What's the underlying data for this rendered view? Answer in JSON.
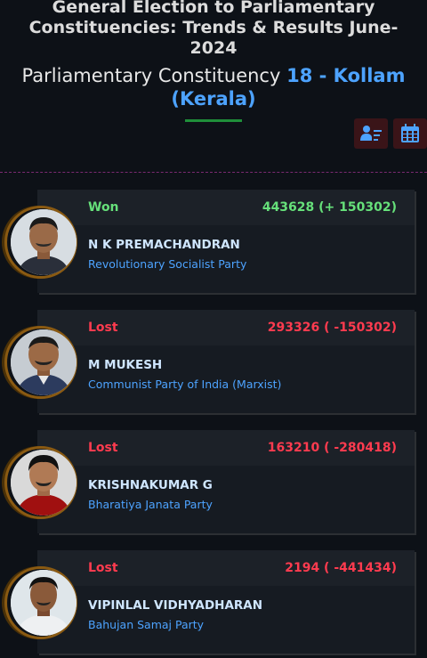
{
  "header": {
    "title": "General Election to Parliamentary Constituencies: Trends & Results June-2024",
    "constituency_label": "Parliamentary Constituency",
    "constituency_name": "18 - Kollam (Kerala)"
  },
  "toolbar": {
    "icons": [
      "sort-list-icon",
      "calendar-icon"
    ],
    "colors": {
      "button_bg": "#3a1418",
      "icon": "#4da3ff"
    }
  },
  "candidates": [
    {
      "status": "Won",
      "votes": "443628 (+ 150302)",
      "name": "N K PREMACHANDRAN",
      "party": "Revolutionary Socialist Party",
      "avatar_bg": "#d7dde2",
      "shirt": "#2a2f3a"
    },
    {
      "status": "Lost",
      "votes": "293326 ( -150302)",
      "name": "M MUKESH",
      "party": "Communist Party of India (Marxist)",
      "avatar_bg": "#c6ccd2",
      "shirt": "#2c3b5e"
    },
    {
      "status": "Lost",
      "votes": "163210 ( -280418)",
      "name": "KRISHNAKUMAR G",
      "party": "Bharatiya Janata Party",
      "avatar_bg": "#d9d9d9",
      "shirt": "#a01010"
    },
    {
      "status": "Lost",
      "votes": "2194 ( -441434)",
      "name": "VIPINLAL VIDHYADHARAN",
      "party": "Bahujan Samaj Party",
      "avatar_bg": "#dfe6ea",
      "shirt": "#eef0f2"
    }
  ],
  "colors": {
    "won": "#66e07a",
    "lost": "#ff3b4f",
    "accent": "#4da3ff",
    "divider": "#7a2a72"
  }
}
